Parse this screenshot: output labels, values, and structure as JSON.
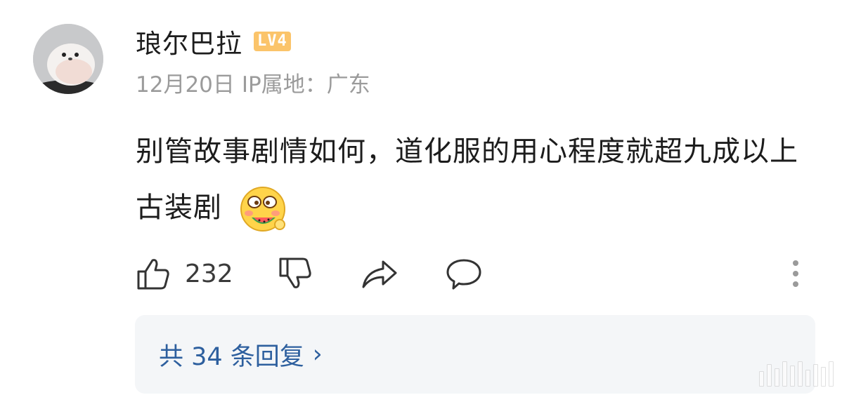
{
  "comment": {
    "user": {
      "name": "琅尔巴拉",
      "level_badge": "LV4",
      "avatar_icon": "white-bird-avatar"
    },
    "meta": {
      "date": "12月20日",
      "ip_location": "IP属地：广东"
    },
    "text": "别管故事剧情如何，道化服的用心程度就超九成以上古装剧",
    "emoji_icon": "eating-watermelon-emoji",
    "actions": {
      "like_count": "232",
      "like_icon": "thumbs-up-icon",
      "dislike_icon": "thumbs-down-icon",
      "share_icon": "share-arrow-icon",
      "comment_icon": "comment-bubble-icon",
      "more_icon": "more-vertical-icon"
    },
    "replies": {
      "label": "共 34 条回复",
      "chevron": "›"
    }
  },
  "colors": {
    "link": "#2d5f9e",
    "meta_text": "#9b9b9b",
    "badge": "#fbc46a",
    "reply_bg": "#f4f6f8"
  }
}
